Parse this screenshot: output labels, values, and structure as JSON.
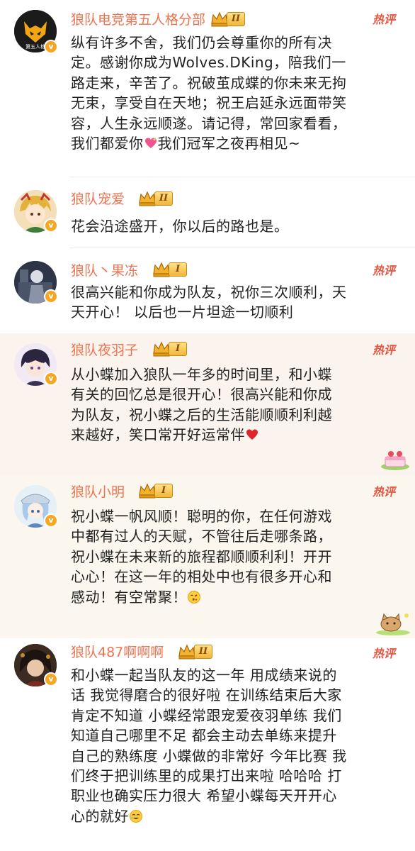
{
  "comments": [
    {
      "username": "狼队电竞第五人格分部",
      "level": "II",
      "hot_label": "热评",
      "lines": [
        "纵有许多不舍，我们仍会尊重你的所有决",
        "定。感谢你成为Wolves.DKing，陪我们一",
        "路走来，辛苦了。祝破茧成蝶的你未来无拘",
        "无束，享受自在天地；祝王启延永远面带笑",
        "容，人生永远顺遂。请记得，常回家看看，",
        "我们都爱你",
        "我们冠军之夜再相见~"
      ],
      "avatar_text": "第五人格",
      "avatar_icon": "wolf-logo-icon",
      "emoji": "sparkling-heart-icon"
    },
    {
      "username": "狼队宠爱",
      "level": "II",
      "lines": [
        "花会沿途盛开，你以后的路也是。"
      ],
      "avatar_icon": "anime-avatar-icon"
    },
    {
      "username": "狼队丶果冻",
      "level": "I",
      "hot_label": "热评",
      "lines": [
        "很高兴能和你成为队友，祝你三次顺利，天",
        "天开心！ 以后也一片坦途一切顺利"
      ],
      "avatar_icon": "anime-avatar-icon"
    },
    {
      "username": "狼队夜羽子",
      "level": "I",
      "hot_label": "热评",
      "lines": [
        "从小蝶加入狼队一年多的时间里，和小蝶",
        "有关的回忆总是很开心！很高兴能和你成",
        "为队友，祝小蝶之后的生活能顺顺利利越",
        "来越好，笑口常开好运常伴"
      ],
      "avatar_icon": "anime-avatar-icon",
      "emoji": "red-heart-icon"
    },
    {
      "username": "狼队小明",
      "level": "I",
      "hot_label": "热评",
      "lines": [
        "祝小蝶一帆风顺！聪明的你，在任何游戏",
        "中都有过人的天赋，不管往后走哪条路，",
        "祝小蝶在未来新的旅程都顺顺利利！开开",
        "心心！在这一年的相处中也有很多开心和",
        "感动！有空常聚！"
      ],
      "avatar_icon": "anime-avatar-icon",
      "emoji": "kiss-face-icon"
    },
    {
      "username": "狼队487啊啊啊",
      "level": "II",
      "hot_label": "热评",
      "lines": [
        "和小蝶一起当队友的这一年 用成绩来说的",
        "话 我觉得磨合的很好啦 在训练结束后大家",
        "肯定不知道 小蝶经常跟宠爱夜羽单练 我们",
        "知道自己哪里不足 都会主动去单练来提升",
        "自己的熟练度 小蝶做的非常好 今年比赛 我",
        "们终于把训练里的成果打出来啦 哈哈哈 打",
        "职业也确实压力很大 希望小蝶每天开开心",
        "心的就好"
      ],
      "avatar_icon": "anime-avatar-icon",
      "emoji": "tearful-smile-icon"
    }
  ],
  "colors": {
    "username": "#eb7350",
    "hot": "#e8533d",
    "text": "#222222",
    "verified_badge": "#f5a623"
  }
}
